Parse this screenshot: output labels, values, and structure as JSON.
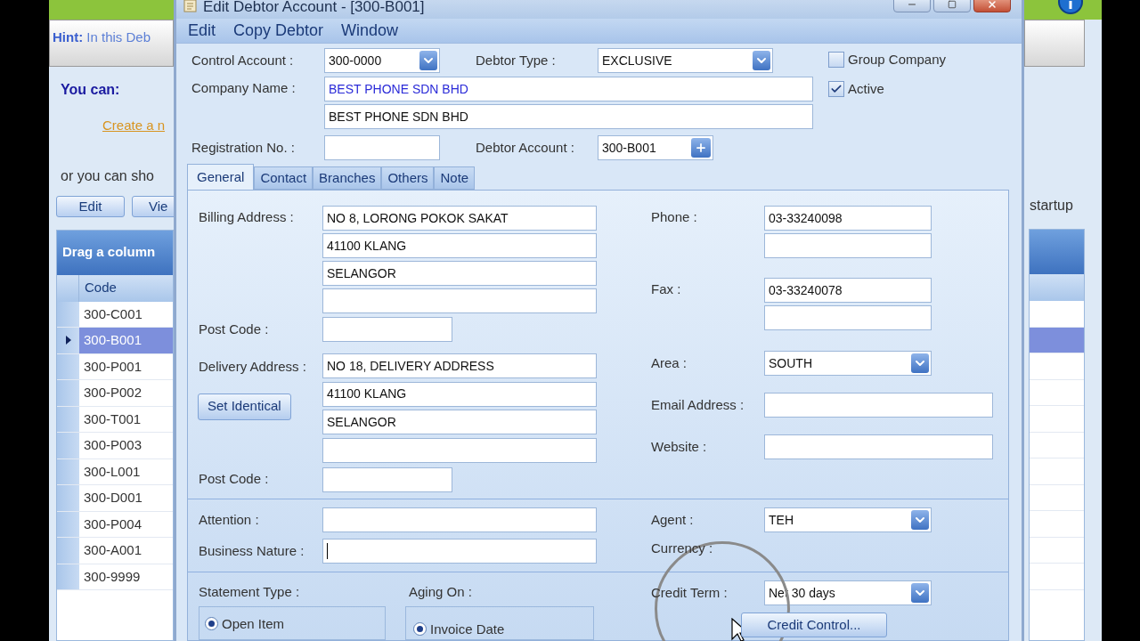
{
  "background_app": {
    "hint": {
      "label": "Hint:",
      "text": "In this Deb"
    },
    "you_can": "You can:",
    "link": "Create a n",
    "or_text": "or you can sho",
    "buttons": [
      "Edit",
      "Vie"
    ],
    "side_text": "startup",
    "grid": {
      "group_hint": "Drag a column",
      "columns": [
        "Code"
      ],
      "rows": [
        {
          "code": "300-C001",
          "selected": false
        },
        {
          "code": "300-B001",
          "selected": true
        },
        {
          "code": "300-P001",
          "selected": false
        },
        {
          "code": "300-P002",
          "selected": false
        },
        {
          "code": "300-T001",
          "selected": false
        },
        {
          "code": "300-P003",
          "selected": false
        },
        {
          "code": "300-L001",
          "selected": false
        },
        {
          "code": "300-D001",
          "selected": false
        },
        {
          "code": "300-P004",
          "selected": false
        },
        {
          "code": "300-A001",
          "selected": false
        },
        {
          "code": "300-9999",
          "selected": false
        }
      ]
    }
  },
  "window": {
    "title": "Edit Debtor Account - [300-B001]"
  },
  "menu": [
    "Edit",
    "Copy Debtor",
    "Window"
  ],
  "header": {
    "control_account": {
      "label": "Control Account :",
      "value": "300-0000",
      "kind": "dropdown"
    },
    "debtor_type": {
      "label": "Debtor Type :",
      "value": "EXCLUSIVE",
      "kind": "dropdown"
    },
    "company_name": {
      "label": "Company Name :",
      "lines": [
        {
          "kind": "text",
          "value": "BEST PHONE SDN BHD",
          "highlighted": true
        },
        {
          "kind": "text",
          "value": "BEST PHONE SDN BHD",
          "highlighted": false
        }
      ]
    },
    "registration_no": {
      "label": "Registration No. :",
      "kind": "text"
    },
    "debtor_account": {
      "label": "Debtor Account :",
      "value": "300-B001",
      "kind": "lookup"
    },
    "checkboxes": [
      {
        "label": "Group Company",
        "checked": false
      },
      {
        "label": "Active",
        "checked": true
      }
    ]
  },
  "tabs": [
    {
      "label": "General",
      "selected": true
    },
    {
      "label": "Contact",
      "selected": false
    },
    {
      "label": "Branches",
      "selected": false
    },
    {
      "label": "Others",
      "selected": false
    },
    {
      "label": "Note",
      "selected": false
    }
  ],
  "general": {
    "billing_address": {
      "label": "Billing Address :",
      "lines": [
        {
          "kind": "text",
          "value": "NO 8, LORONG POKOK SAKAT"
        },
        {
          "kind": "text",
          "value": "41100 KLANG"
        },
        {
          "kind": "text",
          "value": "SELANGOR"
        },
        {
          "kind": "text"
        }
      ]
    },
    "billing_post_code": {
      "label": "Post Code :"
    },
    "delivery_address": {
      "label": "Delivery Address :",
      "button": "Set Identical",
      "lines": [
        {
          "kind": "text",
          "value": "NO 18, DELIVERY ADDRESS"
        },
        {
          "kind": "text",
          "value": "41100 KLANG"
        },
        {
          "kind": "text",
          "value": "SELANGOR"
        },
        {
          "kind": "text"
        }
      ]
    },
    "delivery_post_code": {
      "label": "Post Code :"
    },
    "phone": {
      "label": "Phone :",
      "lines": [
        {
          "kind": "text",
          "value": "03-33240098"
        },
        {
          "kind": "text"
        }
      ]
    },
    "fax": {
      "label": "Fax :",
      "lines": [
        {
          "kind": "text",
          "value": "03-33240078"
        },
        {
          "kind": "text"
        }
      ]
    },
    "area": {
      "label": "Area :",
      "value": "SOUTH",
      "kind": "dropdown"
    },
    "email": {
      "label": "Email  Address :",
      "kind": "text"
    },
    "website": {
      "label": "Website :",
      "kind": "text"
    },
    "attention": {
      "label": "Attention :",
      "focused": false
    },
    "business_nature": {
      "label": "Business Nature :",
      "focused": true
    },
    "agent": {
      "label": "Agent :",
      "value": "TEH",
      "kind": "dropdown"
    },
    "currency": {
      "label": "Currency :"
    },
    "statement_type": {
      "label": "Statement Type :",
      "options": [
        {
          "label": "Open Item",
          "selected": true
        }
      ]
    },
    "aging_on": {
      "label": "Aging On :",
      "options": [
        {
          "label": "Invoice Date",
          "selected": true
        }
      ]
    },
    "credit_term": {
      "label": "Credit Term :",
      "value": "Net 30 days",
      "kind": "dropdown"
    },
    "credit_control_button": "Credit Control..."
  }
}
